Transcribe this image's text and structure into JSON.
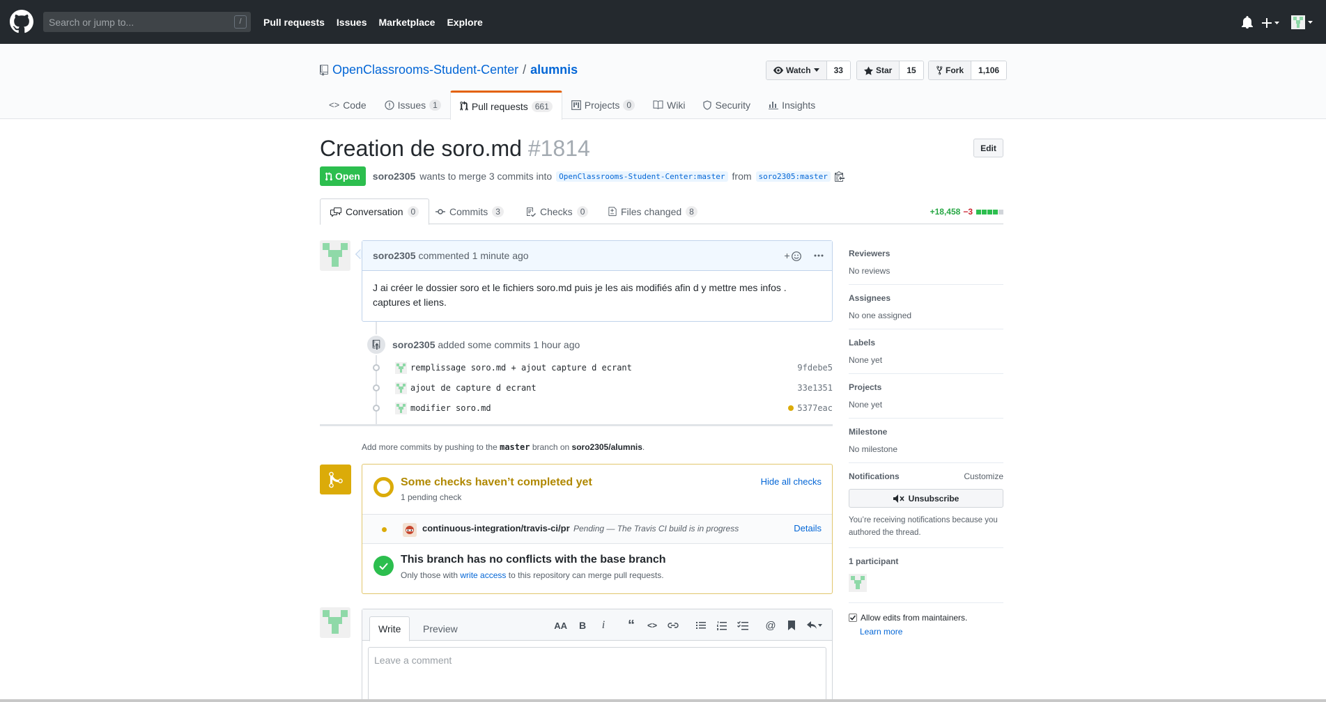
{
  "header": {
    "search_placeholder": "Search or jump to...",
    "search_key": "/",
    "nav": [
      "Pull requests",
      "Issues",
      "Marketplace",
      "Explore"
    ]
  },
  "repo": {
    "owner": "OpenClassrooms-Student-Center",
    "separator": "/",
    "name": "alumnis",
    "watch_label": "Watch",
    "watch_count": "33",
    "star_label": "Star",
    "star_count": "15",
    "fork_label": "Fork",
    "fork_count": "1,106",
    "tabs": [
      {
        "label": "Code",
        "icon": "code-icon",
        "count": ""
      },
      {
        "label": "Issues",
        "icon": "issue-icon",
        "count": "1"
      },
      {
        "label": "Pull requests",
        "icon": "pull-request-icon",
        "count": "661"
      },
      {
        "label": "Projects",
        "icon": "project-icon",
        "count": "0"
      },
      {
        "label": "Wiki",
        "icon": "book-icon",
        "count": ""
      },
      {
        "label": "Security",
        "icon": "shield-icon",
        "count": ""
      },
      {
        "label": "Insights",
        "icon": "graph-icon",
        "count": ""
      }
    ]
  },
  "pr": {
    "title": "Creation de soro.md",
    "number": "#1814",
    "edit_label": "Edit",
    "state": "Open",
    "author": "soro2305",
    "meta_text": "wants to merge 3 commits into",
    "base_ref": "OpenClassrooms-Student-Center:master",
    "from_text": "from",
    "head_ref": "soro2305:master",
    "tabs": [
      {
        "label": "Conversation",
        "count": "0",
        "icon": "comment-discussion-icon"
      },
      {
        "label": "Commits",
        "count": "3",
        "icon": "git-commit-icon"
      },
      {
        "label": "Checks",
        "count": "0",
        "icon": "checklist-icon"
      },
      {
        "label": "Files changed",
        "count": "8",
        "icon": "file-diff-icon"
      }
    ],
    "additions": "+18,458",
    "deletions": "−3"
  },
  "comment": {
    "author": "soro2305",
    "action": "commented",
    "time": "1 minute ago",
    "body": "J ai créer le dossier soro et le fichiers soro.md puis je les ais modifiés afin d y mettre mes infos . captures et liens."
  },
  "commits_event": {
    "author": "soro2305",
    "text": "added some commits",
    "time": "1 hour ago",
    "commits": [
      {
        "message": "remplissage soro.md + ajout capture d ecrant",
        "sha": "9fdebe5"
      },
      {
        "message": "ajout de capture d ecrant",
        "sha": "33e1351"
      },
      {
        "message": "modifier soro.md",
        "sha": "5377eac"
      }
    ]
  },
  "add_more": {
    "prefix": "Add more commits by pushing to the",
    "branch": "master",
    "middle": "branch on",
    "repo": "soro2305/alumnis",
    "suffix": "."
  },
  "checks": {
    "title": "Some checks haven’t completed yet",
    "subtitle": "1 pending check",
    "hide_label": "Hide all checks",
    "ci_name": "continuous-integration/travis-ci/pr",
    "ci_desc": "Pending — The Travis CI build is in progress",
    "details_label": "Details",
    "ok_title": "This branch has no conflicts with the base branch",
    "ok_sub_prefix": "Only those with",
    "ok_sub_link": "write access",
    "ok_sub_suffix": "to this repository can merge pull requests."
  },
  "new_comment": {
    "write_tab": "Write",
    "preview_tab": "Preview",
    "placeholder": "Leave a comment"
  },
  "sidebar": {
    "reviewers_h": "Reviewers",
    "reviewers_v": "No reviews",
    "assignees_h": "Assignees",
    "assignees_v": "No one assigned",
    "labels_h": "Labels",
    "labels_v": "None yet",
    "projects_h": "Projects",
    "projects_v": "None yet",
    "milestone_h": "Milestone",
    "milestone_v": "No milestone",
    "notifications_h": "Notifications",
    "customize": "Customize",
    "unsubscribe": "Unsubscribe",
    "notif_note": "You’re receiving notifications because you authored the thread.",
    "participants_h": "1 participant",
    "allow_edits": "Allow edits from maintainers.",
    "learn_more": "Learn more"
  },
  "colors": {
    "header_bg": "#24292e",
    "open_green": "#2cbe4e",
    "pending_yellow": "#dbab09",
    "link_blue": "#0366d6",
    "tab_accent": "#e36209"
  }
}
